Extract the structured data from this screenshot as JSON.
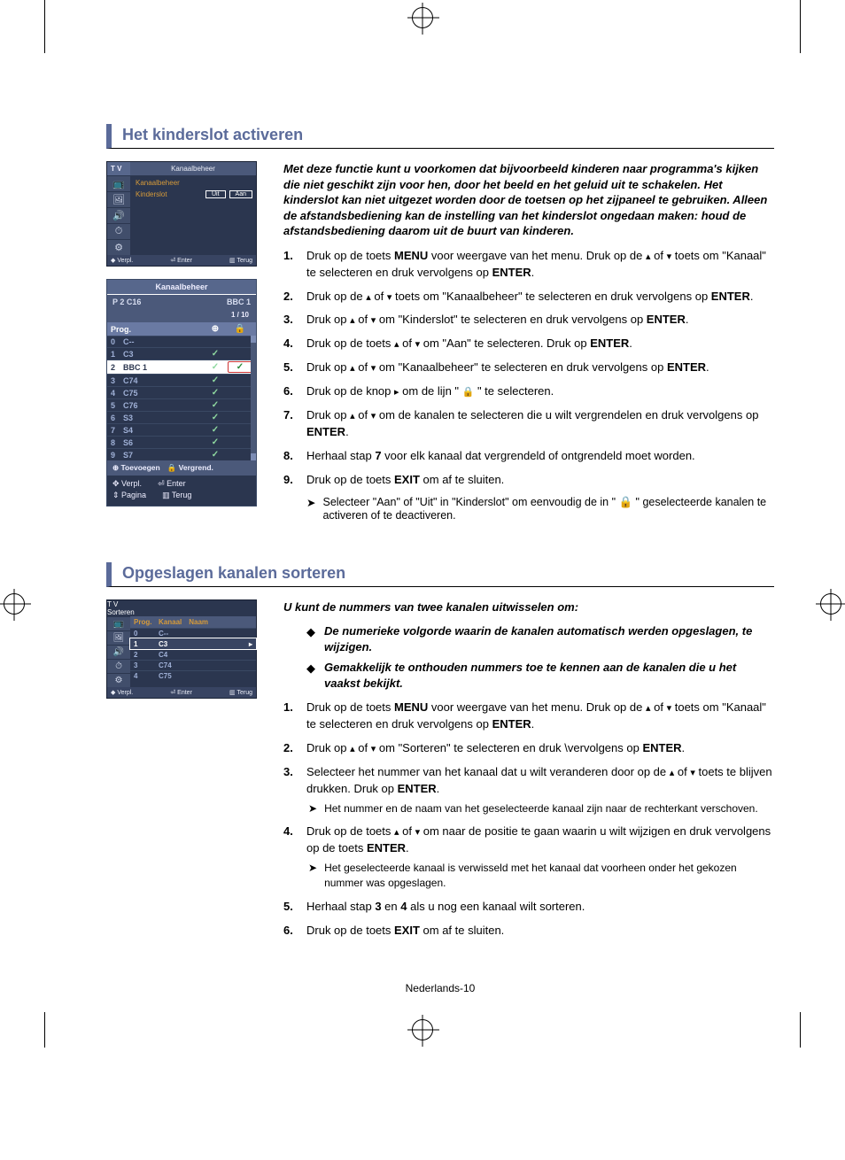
{
  "section1": {
    "heading": "Het kinderslot activeren",
    "intro": "Met deze functie kunt u voorkomen dat bijvoorbeeld kinderen naar programma's kijken die niet geschikt zijn voor hen, door het beeld en het geluid uit te schakelen. Het kinderslot kan niet uitgezet worden door de toetsen op het zijpaneel te gebruiken. Alleen de afstandsbediening kan de instelling van het kinderslot ongedaan maken: houd de afstandsbediening daarom uit de buurt van kinderen.",
    "tvMenu": {
      "tv": "T V",
      "title": "Kanaalbeheer",
      "rows": [
        {
          "label": "Kanaalbeheer",
          "val": ""
        },
        {
          "label": "Kinderslot",
          "val1": "Uit",
          "val2": "Aan"
        }
      ],
      "footer": {
        "a": "◆ Verpl.",
        "b": "⏎ Enter",
        "c": "▥ Terug"
      }
    },
    "chMgr": {
      "title": "Kanaalbeheer",
      "sub_left": "P   2    C16",
      "sub_right": "BBC 1",
      "page": "1 / 10",
      "head": {
        "prog": "Prog.",
        "add": "⊕",
        "lock": "🔒"
      },
      "rows": [
        {
          "n": "0",
          "ch": "C--",
          "add": "",
          "lock": ""
        },
        {
          "n": "1",
          "ch": "C3",
          "add": "✓",
          "lock": ""
        },
        {
          "n": "2",
          "ch": "BBC 1",
          "add": "✓",
          "lock": "✓",
          "active": true
        },
        {
          "n": "3",
          "ch": "C74",
          "add": "✓",
          "lock": ""
        },
        {
          "n": "4",
          "ch": "C75",
          "add": "✓",
          "lock": ""
        },
        {
          "n": "5",
          "ch": "C76",
          "add": "✓",
          "lock": ""
        },
        {
          "n": "6",
          "ch": "S3",
          "add": "✓",
          "lock": ""
        },
        {
          "n": "7",
          "ch": "S4",
          "add": "✓",
          "lock": ""
        },
        {
          "n": "8",
          "ch": "S6",
          "add": "✓",
          "lock": ""
        },
        {
          "n": "9",
          "ch": "S7",
          "add": "✓",
          "lock": ""
        }
      ],
      "actions": {
        "add": "⊕ Toevoegen",
        "lock": "🔒 Vergrend."
      },
      "foot": {
        "a": "✥ Verpl.",
        "b": "⏎ Enter",
        "c": "⇕ Pagina",
        "d": "▥ Terug"
      }
    },
    "steps": {
      "s1a": "Druk op de toets ",
      "s1_menu": "MENU",
      "s1b": " voor weergave van het menu. Druk op de ",
      "s1c": " of ",
      "s1d": " toets om \"Kanaal\" te selecteren en druk vervolgens op ",
      "s1_enter": "ENTER",
      "s1e": ".",
      "s2a": "Druk op de ",
      "s2b": " of ",
      "s2c": " toets om \"Kanaalbeheer\" te selecteren en druk vervolgens op ",
      "s2_enter": "ENTER",
      "s2d": ".",
      "s3a": "Druk op ",
      "s3b": " of ",
      "s3c": " om \"Kinderslot\" te selecteren en druk vervolgens op ",
      "s3_enter": "ENTER",
      "s3d": ".",
      "s4a": "Druk op de toets ",
      "s4b": " of ",
      "s4c": " om \"Aan\" te selecteren. Druk op ",
      "s4_enter": "ENTER",
      "s4d": ".",
      "s5a": "Druk op ",
      "s5b": " of ",
      "s5c": " om \"Kanaalbeheer\" te selecteren en druk vervolgens op ",
      "s5_enter": "ENTER",
      "s5d": ".",
      "s6a": "Druk op de knop ",
      "s6b": " om de lijn \" ",
      "s6c": " \" te selecteren.",
      "s7a": "Druk op ",
      "s7b": " of ",
      "s7c": " om de kanalen te selecteren die u wilt vergrendelen en druk vervolgens op ",
      "s7_enter": "ENTER",
      "s7d": ".",
      "s8a": "Herhaal stap ",
      "s8_7": "7",
      "s8b": " voor elk kanaal dat vergrendeld of ontgrendeld moet worden.",
      "s9a": "Druk op de toets ",
      "s9_exit": "EXIT",
      "s9b": " om af te sluiten."
    },
    "note": "Selecteer \"Aan\" of \"Uit\" in \"Kinderslot\" om eenvoudig de in \" 🔒 \" geselecteerde kanalen te activeren of te deactiveren."
  },
  "section2": {
    "heading": "Opgeslagen kanalen sorteren",
    "intro": "U kunt de nummers van twee kanalen uitwisselen om:",
    "bullets": [
      "De numerieke volgorde waarin de kanalen automatisch werden opgeslagen, te wijzigen.",
      "Gemakkelijk te onthouden nummers toe te kennen aan de kanalen die u het vaakst bekijkt."
    ],
    "sortMenu": {
      "tv": "T V",
      "title": "Sorteren",
      "head": {
        "a": "Prog.",
        "b": "Kanaal",
        "c": "Naam"
      },
      "rows": [
        {
          "n": "0",
          "ch": "C--"
        },
        {
          "n": "1",
          "ch": "C3",
          "sel": true
        },
        {
          "n": "2",
          "ch": "C4"
        },
        {
          "n": "3",
          "ch": "C74"
        },
        {
          "n": "4",
          "ch": "C75"
        }
      ],
      "footer": {
        "a": "◆ Verpl.",
        "b": "⏎ Enter",
        "c": "▥ Terug"
      }
    },
    "steps": {
      "s1a": "Druk op de toets ",
      "s1_menu": "MENU",
      "s1b": " voor weergave van het menu. Druk op de ",
      "s1c": " of ",
      "s1d": " toets om \"Kanaal\" te selecteren en druk vervolgens op ",
      "s1_enter": "ENTER",
      "s1e": ".",
      "s2a": "Druk op ",
      "s2b": " of ",
      "s2c": " om \"Sorteren\" te selecteren en druk \\vervolgens op ",
      "s2_enter": "ENTER",
      "s2d": ".",
      "s3a": "Selecteer het nummer van het kanaal dat u wilt veranderen door op de ",
      "s3b": " of ",
      "s3c": " toets te blijven drukken. Druk op ",
      "s3_enter": "ENTER",
      "s3d": ".",
      "s3_note": "Het nummer en de naam van het geselecteerde kanaal zijn naar de rechterkant verschoven.",
      "s4a": "Druk op de toets ",
      "s4b": " of ",
      "s4c": " om naar de positie te gaan waarin u wilt wijzigen en druk vervolgens op de toets ",
      "s4_enter": "ENTER",
      "s4d": ".",
      "s4_note": "Het geselecteerde kanaal is verwisseld met het kanaal dat voorheen onder het gekozen nummer was opgeslagen.",
      "s5a": "Herhaal stap ",
      "s5_3": "3",
      "s5b": " en ",
      "s5_4": "4",
      "s5c": " als u nog een kanaal wilt sorteren.",
      "s6a": "Druk op de toets ",
      "s6_exit": "EXIT",
      "s6b": " om af te sluiten."
    }
  },
  "pageNum": "Nederlands-10"
}
